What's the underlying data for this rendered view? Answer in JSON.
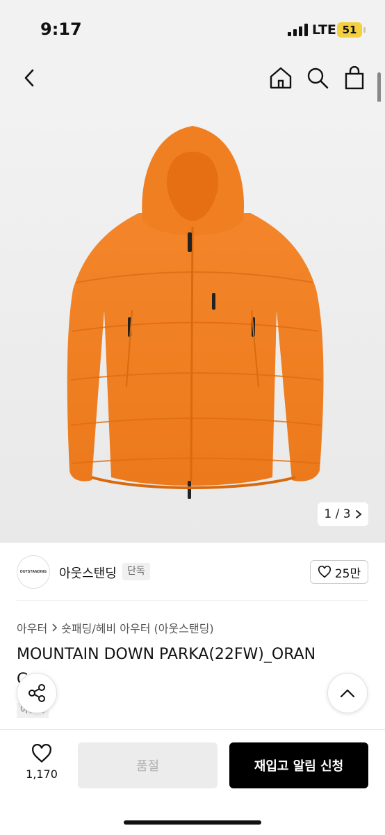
{
  "status_bar": {
    "time": "9:17",
    "network": "LTE",
    "battery": "51"
  },
  "nav": {
    "back_icon": "chevron-left-icon",
    "home_icon": "home-icon",
    "search_icon": "search-icon",
    "bag_icon": "shopping-bag-icon"
  },
  "gallery": {
    "counter": "1 / 3",
    "current": 1,
    "total": 3
  },
  "seller": {
    "logo_text": "OUTSTANDING",
    "name": "아웃스탠딩",
    "badge": "단독",
    "likes": "25만"
  },
  "breadcrumb": [
    "아우터",
    "숏패딩/헤비 아우터 (아웃스탠딩)"
  ],
  "product": {
    "title": "MOUNTAIN DOWN PARKA(22FW)_ORAN",
    "title_overflow": "G",
    "sub_badge": "아웃핏"
  },
  "bottom_bar": {
    "wish_count": "1,170",
    "soldout_label": "품절",
    "restock_label": "재입고 알림 신청"
  },
  "colors": {
    "accent": "#000000",
    "jacket": "#f07f22",
    "disabled": "#ececec",
    "battery": "#f4d03f"
  }
}
